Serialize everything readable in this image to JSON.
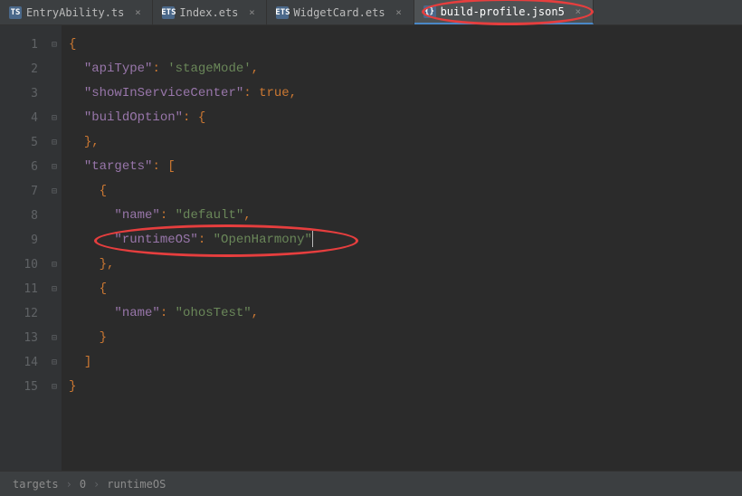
{
  "tabs": [
    {
      "icon": "TS",
      "label": "EntryAbility.ts",
      "active": false
    },
    {
      "icon": "ETS",
      "label": "Index.ets",
      "active": false
    },
    {
      "icon": "ETS",
      "label": "WidgetCard.ets",
      "active": false
    },
    {
      "icon": "{}",
      "label": "build-profile.json5",
      "active": true
    }
  ],
  "lines": [
    "1",
    "2",
    "3",
    "4",
    "5",
    "6",
    "7",
    "8",
    "9",
    "10",
    "11",
    "12",
    "13",
    "14",
    "15"
  ],
  "code": {
    "l1": "{",
    "l2_key": "\"apiType\"",
    "l2_val": "'stageMode'",
    "l3_key": "\"showInServiceCenter\"",
    "l3_val": "true",
    "l4_key": "\"buildOption\"",
    "l6_key": "\"targets\"",
    "l8_key": "\"name\"",
    "l8_val": "\"default\"",
    "l9_key": "\"runtimeOS\"",
    "l9_val": "\"OpenHarmony\"",
    "l12_key": "\"name\"",
    "l12_val": "\"ohosTest\""
  },
  "breadcrumb": {
    "p1": "targets",
    "p2": "0",
    "p3": "runtimeOS"
  },
  "chart_data": {
    "type": "table",
    "title": "build-profile.json5 contents",
    "content": {
      "apiType": "stageMode",
      "showInServiceCenter": true,
      "buildOption": {},
      "targets": [
        {
          "name": "default",
          "runtimeOS": "OpenHarmony"
        },
        {
          "name": "ohosTest"
        }
      ]
    }
  }
}
